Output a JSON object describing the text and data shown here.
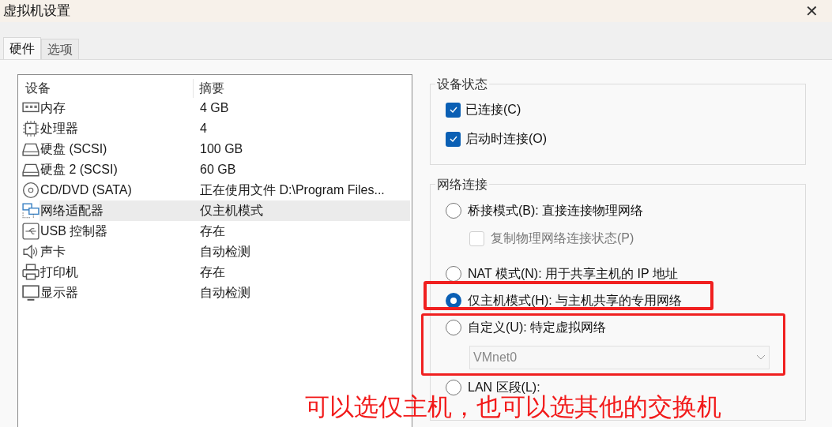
{
  "window": {
    "title": "虚拟机设置",
    "close": "✕"
  },
  "tabs": [
    {
      "label": "硬件",
      "selected": true
    },
    {
      "label": "选项",
      "selected": false
    }
  ],
  "device_table": {
    "columns": [
      "设备",
      "摘要"
    ],
    "rows": [
      {
        "kind": "memory",
        "device": "内存",
        "summary": "4 GB",
        "selected": false
      },
      {
        "kind": "cpu",
        "device": "处理器",
        "summary": "4",
        "selected": false
      },
      {
        "kind": "disk",
        "device": "硬盘 (SCSI)",
        "summary": "100 GB",
        "selected": false
      },
      {
        "kind": "disk",
        "device": "硬盘 2 (SCSI)",
        "summary": "60 GB",
        "selected": false
      },
      {
        "kind": "cd",
        "device": "CD/DVD (SATA)",
        "summary": "正在使用文件 D:\\Program Files...",
        "selected": false
      },
      {
        "kind": "network",
        "device": "网络适配器",
        "summary": "仅主机模式",
        "selected": true
      },
      {
        "kind": "usb",
        "device": "USB 控制器",
        "summary": "存在",
        "selected": false
      },
      {
        "kind": "sound",
        "device": "声卡",
        "summary": "自动检测",
        "selected": false
      },
      {
        "kind": "printer",
        "device": "打印机",
        "summary": "存在",
        "selected": false
      },
      {
        "kind": "display",
        "device": "显示器",
        "summary": "自动检测",
        "selected": false
      }
    ]
  },
  "device_status": {
    "title": "设备状态",
    "options": [
      {
        "label": "已连接(C)",
        "checked": true
      },
      {
        "label": "启动时连接(O)",
        "checked": true
      }
    ]
  },
  "network_connection": {
    "title": "网络连接",
    "items": [
      {
        "kind": "radio",
        "label": "桥接模式(B): 直接连接物理网络",
        "selected": false
      },
      {
        "kind": "checkbox",
        "label": "复制物理网络连接状态(P)",
        "checked": false,
        "disabled": true
      },
      {
        "kind": "radio",
        "label": "NAT 模式(N): 用于共享主机的 IP 地址",
        "selected": false
      },
      {
        "kind": "radio",
        "label": "仅主机模式(H): 与主机共享的专用网络",
        "selected": true
      },
      {
        "kind": "radio",
        "label": "自定义(U): 特定虚拟网络",
        "selected": false
      },
      {
        "kind": "dropdown",
        "value": "VMnet0",
        "disabled": true
      },
      {
        "kind": "radio",
        "label": "LAN 区段(L):",
        "selected": false
      }
    ]
  },
  "annotation": {
    "text": "可以选仅主机，也可以选其他的交换机"
  }
}
